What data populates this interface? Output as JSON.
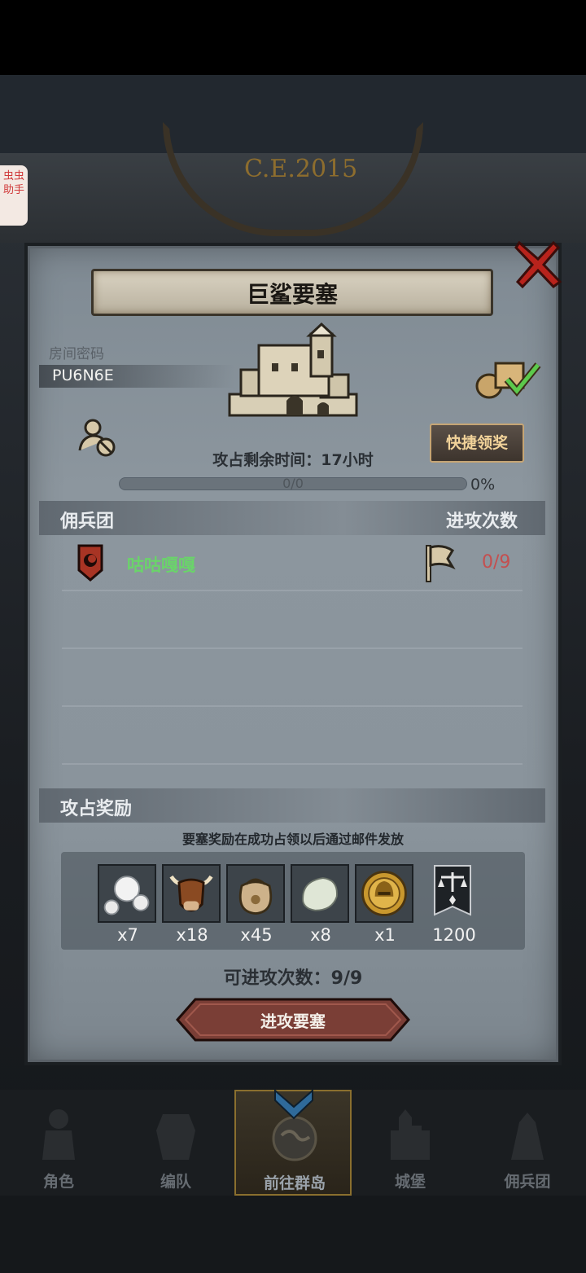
{
  "helper_tab": {
    "label": "虫虫助手"
  },
  "background": {
    "map_year": "C.E.2015"
  },
  "panel": {
    "title": "巨鲨要塞",
    "room_label": "房间密码",
    "room_code": "PU6N6E",
    "quick_claim_label": "快捷领奖",
    "remaining_time": "攻占剩余时间：17小时",
    "progress": {
      "text": "0/0",
      "percent_label": "0%",
      "value": 0
    },
    "mercenary_section": {
      "title": "佣兵团",
      "attack_header": "进攻次数"
    },
    "guilds": [
      {
        "name": "咕咕嘎嘎",
        "attacks": "0/9"
      }
    ],
    "rewards_section": {
      "title": "攻占奖励",
      "hint": "要塞奖励在成功占领以后通过邮件发放",
      "items": [
        {
          "icon": "pearl-icon",
          "qty": "x7"
        },
        {
          "icon": "ox-icon",
          "qty": "x18"
        },
        {
          "icon": "sack-icon",
          "qty": "x45"
        },
        {
          "icon": "stone-icon",
          "qty": "x8"
        },
        {
          "icon": "helmet-coin-icon",
          "qty": "x1"
        },
        {
          "icon": "justice-banner-icon",
          "qty": "1200"
        }
      ]
    },
    "attacks_left": "可进攻次数：9/9",
    "attack_button": "进攻要塞"
  },
  "bottom_nav": {
    "items": [
      {
        "label": "角色",
        "icon": "knight-icon"
      },
      {
        "label": "编队",
        "icon": "armor-icon"
      },
      {
        "label": "前往群岛",
        "icon": "globe-icon",
        "active": true
      },
      {
        "label": "城堡",
        "icon": "castle-icon"
      },
      {
        "label": "佣兵团",
        "icon": "mercenary-icon"
      }
    ]
  },
  "colors": {
    "guild_name": "#6ad46a",
    "attack_count": "#c44f4f",
    "quick_button_text": "#f2d39a",
    "attack_button": "#7a3e36"
  }
}
